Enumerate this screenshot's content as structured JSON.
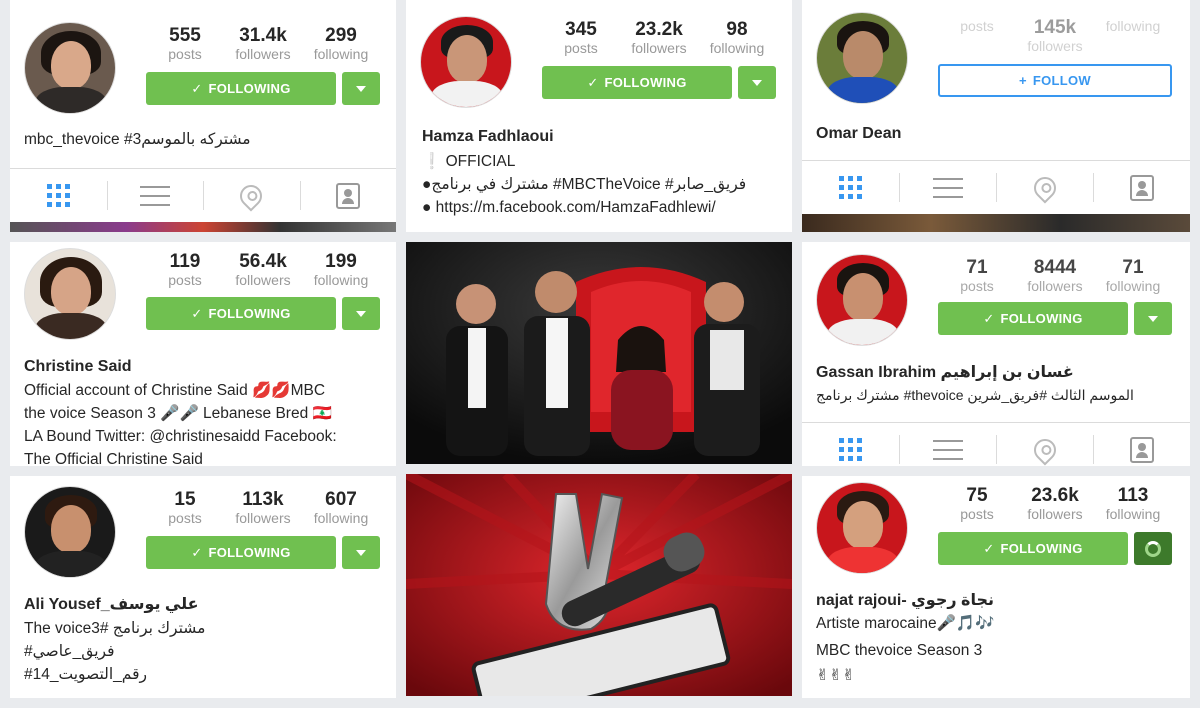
{
  "profiles": [
    {
      "id": "p1",
      "posts": "555",
      "followers": "31.4k",
      "following": "299",
      "posts_label": "posts",
      "followers_label": "followers",
      "following_label": "following",
      "button_label": "FOLLOWING",
      "name": "",
      "bio": [
        "mbc_thevoice #مشتركه بالموسم3"
      ]
    },
    {
      "id": "p2",
      "posts": "345",
      "followers": "23.2k",
      "following": "98",
      "posts_label": "posts",
      "followers_label": "followers",
      "following_label": "following",
      "button_label": "FOLLOWING",
      "name": "Hamza Fadhlaoui",
      "bio": [
        "❕ OFFICIAL",
        "●مشترك في برنامج #MBCTheVoice #فريق_صابر",
        "● https://m.facebook.com/HamzaFadhlewi/"
      ]
    },
    {
      "id": "p3",
      "posts": "",
      "followers": "145k",
      "following": "",
      "posts_label": "posts",
      "followers_label": "followers",
      "following_label": "following",
      "button_label": "FOLLOW",
      "name": "Omar Dean",
      "bio": []
    },
    {
      "id": "p4",
      "posts": "119",
      "followers": "56.4k",
      "following": "199",
      "posts_label": "posts",
      "followers_label": "followers",
      "following_label": "following",
      "button_label": "FOLLOWING",
      "name": "Christine Said",
      "bio": [
        "Official account of Christine Said 💋💋MBC",
        "the voice Season 3 🎤🎤 Lebanese Bred 🇱🇧",
        "LA Bound Twitter: @christinesaidd Facebook:",
        "The Official Christine Said"
      ]
    },
    {
      "id": "p5",
      "posts": "71",
      "followers": "8444",
      "following": "71",
      "posts_label": "posts",
      "followers_label": "followers",
      "following_label": "following",
      "button_label": "FOLLOWING",
      "name": "Gassan Ibrahim غسان بن إبراهيم",
      "bio": [
        "مشترك برنامج #thevoice الموسم الثالث #فريق_شرين"
      ]
    },
    {
      "id": "p6",
      "posts": "15",
      "followers": "113k",
      "following": "607",
      "posts_label": "posts",
      "followers_label": "followers",
      "following_label": "following",
      "button_label": "FOLLOWING",
      "name": "Ali Yousef_علي يوسف",
      "bio": [
        "The voice3# مشترك برنامج",
        "#فريق_عاصي",
        "#رقم_التصويت_14"
      ]
    },
    {
      "id": "p7",
      "posts": "75",
      "followers": "23.6k",
      "following": "113",
      "posts_label": "posts",
      "followers_label": "followers",
      "following_label": "following",
      "button_label": "FOLLOWING",
      "name": "najat rajoui- نجاة رجوي",
      "bio": [
        "Artiste marocaine🎤🎵🎶",
        "MBC thevoice Season 3",
        "✌✌✌"
      ]
    }
  ],
  "colors": {
    "following_green": "#70c050",
    "follow_blue": "#3897f0",
    "coach_red": "#c8161c"
  },
  "icons": {
    "check": "check-icon",
    "plus": "plus-icon",
    "dropdown": "chevron-down-icon",
    "grid": "grid-icon",
    "list": "list-icon",
    "location": "location-pin-icon",
    "tagged": "tagged-user-icon",
    "microphone": "microphone-icon"
  }
}
